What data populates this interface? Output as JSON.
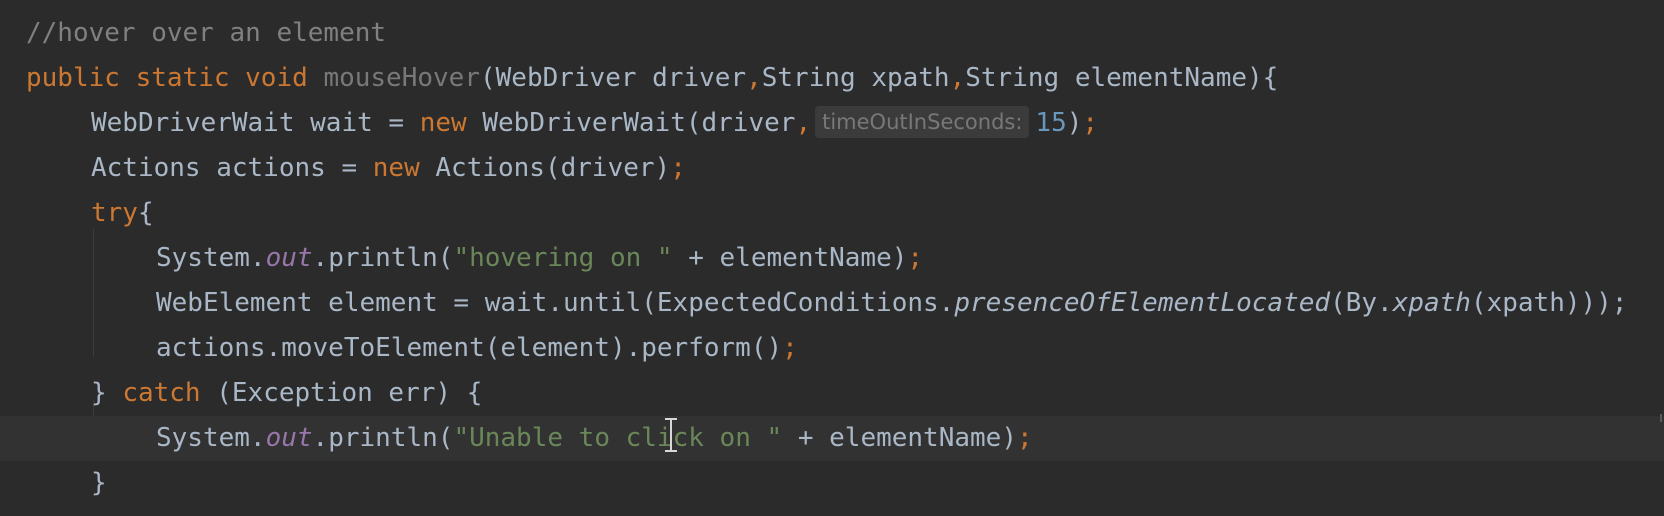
{
  "editor": {
    "lines": [
      {
        "comment": "//hover over an element"
      },
      {
        "kw_public": "public",
        "kw_static": "static",
        "kw_void": "void",
        "method_name": "mouseHover",
        "params_open": "(WebDriver driver",
        "comma1": ",",
        "param2": "String xpath",
        "comma2": ",",
        "param3": "String elementName){"
      },
      {
        "decl": "WebDriverWait wait = ",
        "kw_new": "new",
        "ctor": " WebDriverWait(driver",
        "comma": ",",
        "hint": "timeOutInSeconds:",
        "num": "15",
        "close": ")",
        "semi": ";"
      },
      {
        "decl": "Actions actions = ",
        "kw_new": "new",
        "ctor": " Actions(driver)",
        "semi": ";"
      },
      {
        "kw_try": "try",
        "brace": "{"
      },
      {
        "sys": "System.",
        "out": "out",
        "call": ".println(",
        "str": "\"hovering on \"",
        "rest": " + elementName)",
        "semi": ";"
      },
      {
        "decl": "WebElement element = wait.until(ExpectedConditions.",
        "italic1": "presenceOfElementLocated",
        "mid": "(By.",
        "italic2": "xpath",
        "rest": "(xpath)));"
      },
      {
        "code": "actions.moveToElement(element).perform()",
        "semi": ";"
      },
      {
        "open": "} ",
        "kw_catch": "catch",
        "rest": " (Exception err) {"
      },
      {
        "sys": "System.",
        "out": "out",
        "call": ".println(",
        "str": "\"Unable to click on \"",
        "rest": " + elementName)",
        "semi": ";"
      },
      {
        "brace": "}"
      }
    ]
  }
}
